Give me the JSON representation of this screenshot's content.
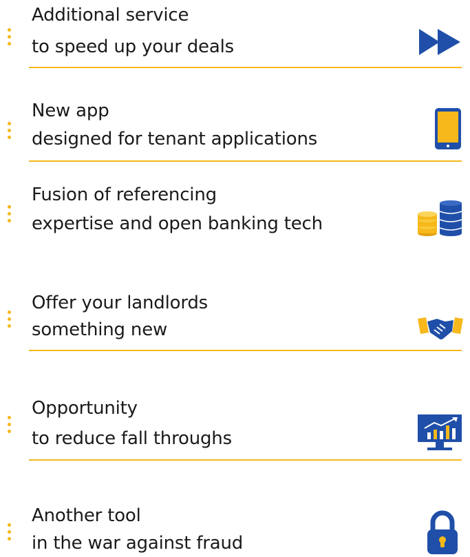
{
  "colors": {
    "accent": "#f6b81a",
    "primary": "#1f4fa8",
    "text": "#1a1a1a"
  },
  "features": [
    {
      "line1": "Additional service",
      "line2": "to speed up your deals",
      "icon": "fast-forward-icon"
    },
    {
      "line1": "New app",
      "line2": "designed for tenant applications",
      "icon": "tablet-icon"
    },
    {
      "line1": "Fusion of referencing",
      "line2": "expertise and open banking tech",
      "icon": "coins-stack-icon"
    },
    {
      "line1": "Offer your landlords",
      "line2": "something new",
      "icon": "handshake-icon"
    },
    {
      "line1": "Opportunity",
      "line2": "to reduce fall throughs",
      "icon": "growth-chart-monitor-icon"
    },
    {
      "line1": "Another tool",
      "line2": "in the war against fraud",
      "icon": "padlock-icon"
    }
  ]
}
